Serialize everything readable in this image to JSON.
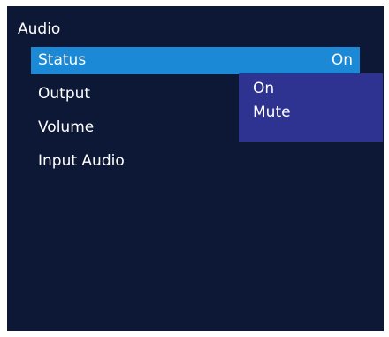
{
  "menu": {
    "title": "Audio",
    "items": [
      {
        "label": "Status",
        "value": "On"
      },
      {
        "label": "Output"
      },
      {
        "label": "Volume"
      },
      {
        "label": "Input Audio"
      }
    ]
  },
  "dropdown": {
    "options": [
      "On",
      "Mute"
    ]
  },
  "colors": {
    "background": "#0d1836",
    "highlight": "#1b89d6",
    "dropdown": "#2e3391",
    "text": "#ffffff"
  }
}
